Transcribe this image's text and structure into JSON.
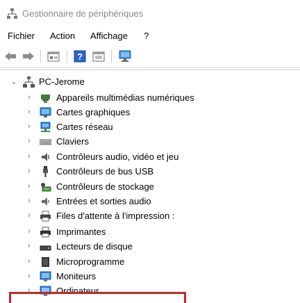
{
  "window": {
    "title": "Gestionnaire de périphériques"
  },
  "menubar": {
    "items": [
      "Fichier",
      "Action",
      "Affichage",
      "?"
    ]
  },
  "toolbar": {
    "buttons": [
      "back-arrow-icon",
      "forward-arrow-icon",
      "properties-icon",
      "help-icon",
      "update-driver-icon",
      "scan-hardware-icon"
    ]
  },
  "tree": {
    "root": {
      "label": "PC-Jerome",
      "expanded": true
    },
    "categories": [
      {
        "label": "Appareils multimédias numériques",
        "icon": "multimedia-device-icon"
      },
      {
        "label": "Cartes graphiques",
        "icon": "display-adapter-icon"
      },
      {
        "label": "Cartes réseau",
        "icon": "network-adapter-icon"
      },
      {
        "label": "Claviers",
        "icon": "keyboard-icon"
      },
      {
        "label": "Contrôleurs audio, vidéo et jeu",
        "icon": "audio-controller-icon"
      },
      {
        "label": "Contrôleurs de bus USB",
        "icon": "usb-icon"
      },
      {
        "label": "Contrôleurs de stockage",
        "icon": "storage-controller-icon"
      },
      {
        "label": "Entrées et sorties audio",
        "icon": "audio-io-icon"
      },
      {
        "label": "Files d'attente à l'impression :",
        "icon": "print-queue-icon"
      },
      {
        "label": "Imprimantes",
        "icon": "printer-icon",
        "highlighted": true
      },
      {
        "label": "Lecteurs de disque",
        "icon": "disk-drive-icon"
      },
      {
        "label": "Microprogramme",
        "icon": "firmware-icon"
      },
      {
        "label": "Moniteurs",
        "icon": "monitor-icon"
      },
      {
        "label": "Ordinateur",
        "icon": "computer-icon"
      }
    ]
  },
  "colors": {
    "highlight_border": "#c0272d",
    "title_text": "#8a8a8a",
    "icon_blue": "#2b7cd3"
  }
}
